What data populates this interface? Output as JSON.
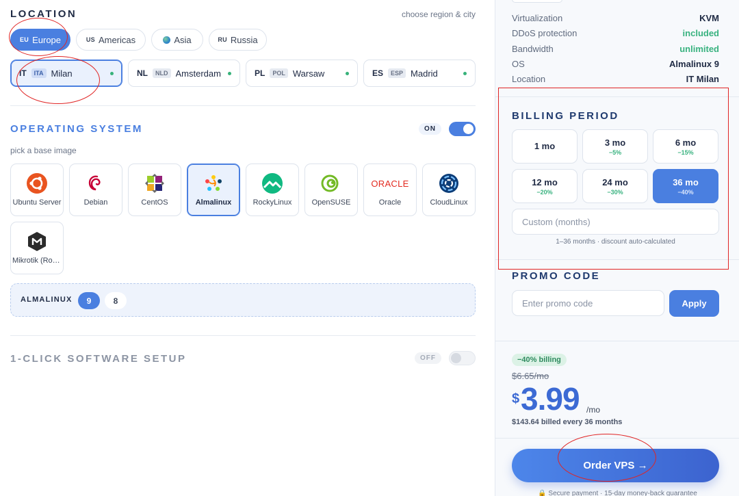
{
  "location": {
    "title": "LOCATION",
    "hint": "choose region & city",
    "regions": [
      {
        "code": "EU",
        "label": "Europe",
        "active": true
      },
      {
        "code": "US",
        "label": "Americas",
        "active": false
      },
      {
        "code": "",
        "label": "Asia",
        "icon": "globe-icon",
        "active": false
      },
      {
        "code": "RU",
        "label": "Russia",
        "active": false
      }
    ],
    "cities": [
      {
        "cc": "IT",
        "iso": "ITA",
        "name": "Milan",
        "active": true
      },
      {
        "cc": "NL",
        "iso": "NLD",
        "name": "Amsterdam",
        "active": false
      },
      {
        "cc": "PL",
        "iso": "POL",
        "name": "Warsaw",
        "active": false
      },
      {
        "cc": "ES",
        "iso": "ESP",
        "name": "Madrid",
        "active": false
      }
    ]
  },
  "os_section": {
    "title": "OPERATING SYSTEM",
    "toggle_label": "ON",
    "toggle_on": true,
    "hint": "pick a base image",
    "images": [
      {
        "label": "Ubuntu Server",
        "icon": "ubuntu-icon",
        "active": false
      },
      {
        "label": "Debian",
        "icon": "debian-icon",
        "active": false
      },
      {
        "label": "CentOS",
        "icon": "centos-icon",
        "active": false
      },
      {
        "label": "Almalinux",
        "icon": "almalinux-icon",
        "active": true
      },
      {
        "label": "RockyLinux",
        "icon": "rockylinux-icon",
        "active": false
      },
      {
        "label": "OpenSUSE",
        "icon": "opensuse-icon",
        "active": false
      },
      {
        "label": "Oracle",
        "icon": "oracle-icon",
        "logo_text": "ORACLE",
        "active": false
      },
      {
        "label": "CloudLinux",
        "icon": "cloudlinux-icon",
        "active": false
      },
      {
        "label": "Mikrotik (RouterOS)",
        "icon": "mikrotik-icon",
        "active": false
      }
    ],
    "version_label": "ALMALINUX",
    "versions": [
      {
        "label": "9",
        "active": true
      },
      {
        "label": "8",
        "active": false
      }
    ]
  },
  "software": {
    "title": "1-CLICK SOFTWARE SETUP",
    "toggle_label": "OFF",
    "toggle_on": false
  },
  "summary": {
    "specs": [
      {
        "key": "Virtualization",
        "value": "KVM",
        "style": "normal"
      },
      {
        "key": "DDoS protection",
        "value": "included",
        "style": "green"
      },
      {
        "key": "Bandwidth",
        "value": "unlimited",
        "style": "green"
      },
      {
        "key": "OS",
        "value": "Almalinux 9",
        "style": "normal"
      },
      {
        "key": "Location",
        "value": "IT Milan",
        "style": "normal"
      }
    ]
  },
  "billing": {
    "title": "BILLING PERIOD",
    "periods": [
      {
        "label": "1 mo",
        "discount": "",
        "active": false
      },
      {
        "label": "3 mo",
        "discount": "−5%",
        "active": false
      },
      {
        "label": "6 mo",
        "discount": "−15%",
        "active": false
      },
      {
        "label": "12 mo",
        "discount": "−20%",
        "active": false
      },
      {
        "label": "24 mo",
        "discount": "−30%",
        "active": false
      },
      {
        "label": "36 mo",
        "discount": "−40%",
        "active": true
      }
    ],
    "custom_placeholder": "Custom (months)",
    "custom_hint": "1–36 months · discount auto-calculated"
  },
  "promo": {
    "title": "PROMO CODE",
    "placeholder": "Enter promo code",
    "apply_label": "Apply"
  },
  "price": {
    "badge": "−40% billing",
    "old_price": "$6.65/mo",
    "currency": "$",
    "amount": "3.99",
    "per": "/mo",
    "billed_note": "$143.64 billed every 36 months",
    "order_label": "Order VPS →",
    "footer_note": "🔒 Secure payment · 15-day money-back guarantee"
  },
  "colors": {
    "accent": "#4a7fe0",
    "green": "#38b27f",
    "annotation": "#e02424"
  }
}
